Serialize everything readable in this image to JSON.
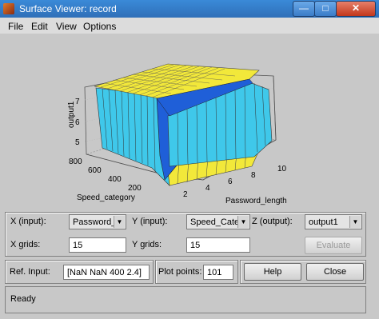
{
  "window": {
    "title": "Surface Viewer: record"
  },
  "menu": [
    "File",
    "Edit",
    "View",
    "Options"
  ],
  "plot": {
    "zlabel": "output1",
    "xlabel": "Password_length",
    "ylabel": "Speed_category",
    "z_ticks": [
      "7",
      "6",
      "5"
    ],
    "x_ticks": [
      "2",
      "4",
      "6",
      "8",
      "10"
    ],
    "y_ticks": [
      "800",
      "600",
      "400",
      "200"
    ]
  },
  "controls": {
    "x_input_label": "X (input):",
    "x_input_value": "Password_...",
    "y_input_label": "Y (input):",
    "y_input_value": "Speed_Cate...",
    "z_output_label": "Z (output):",
    "z_output_value": "output1",
    "x_grids_label": "X grids:",
    "x_grids_value": "15",
    "y_grids_label": "Y grids:",
    "y_grids_value": "15",
    "evaluate_label": "Evaluate",
    "ref_input_label": "Ref. Input:",
    "ref_input_value": "[NaN NaN 400 2.4]",
    "plot_points_label": "Plot points:",
    "plot_points_value": "101",
    "help_label": "Help",
    "close_label": "Close"
  },
  "status": {
    "text": "Ready"
  },
  "colors": {
    "surface_high": "#f2e83a",
    "surface_mid": "#3fc8ea",
    "surface_steep": "#1f5fd8",
    "surface_low": "#f2e83a"
  }
}
